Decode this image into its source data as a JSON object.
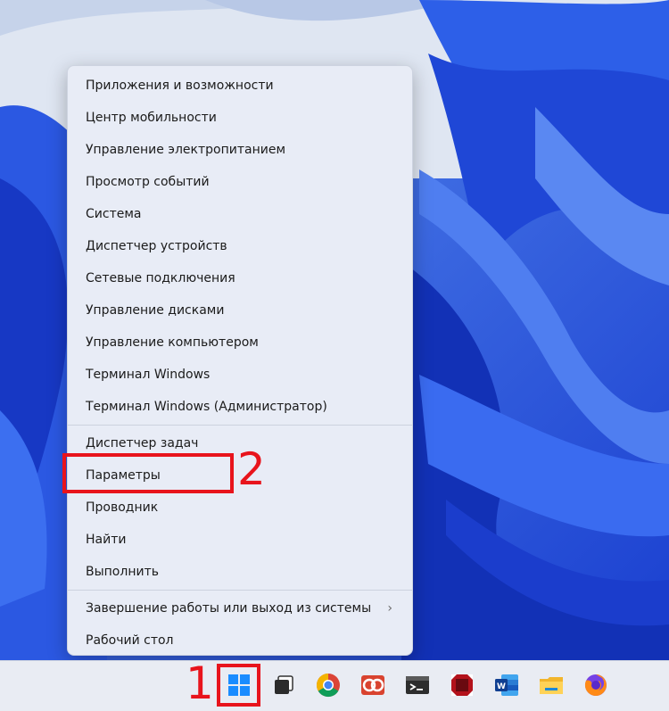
{
  "menu": {
    "items": [
      {
        "label": "Приложения и возможности"
      },
      {
        "label": "Центр мобильности"
      },
      {
        "label": "Управление электропитанием"
      },
      {
        "label": "Просмотр событий"
      },
      {
        "label": "Система"
      },
      {
        "label": "Диспетчер устройств"
      },
      {
        "label": "Сетевые подключения"
      },
      {
        "label": "Управление дисками"
      },
      {
        "label": "Управление компьютером"
      },
      {
        "label": "Терминал Windows"
      },
      {
        "label": "Терминал Windows (Администратор)"
      },
      {
        "label": "Диспетчер задач"
      },
      {
        "label": "Параметры"
      },
      {
        "label": "Проводник"
      },
      {
        "label": "Найти"
      },
      {
        "label": "Выполнить"
      },
      {
        "label": "Завершение работы или выход из системы",
        "submenu_icon": "chevron-right-icon"
      },
      {
        "label": "Рабочий стол"
      }
    ]
  },
  "annotations": {
    "one": "1",
    "two": "2",
    "color": "#e8141c"
  },
  "taskbar": {
    "icons": [
      "windows-start-icon",
      "task-view-icon",
      "chrome-icon",
      "app-icon",
      "terminal-icon",
      "capture-app-icon",
      "word-icon",
      "file-explorer-icon",
      "firefox-icon"
    ]
  }
}
